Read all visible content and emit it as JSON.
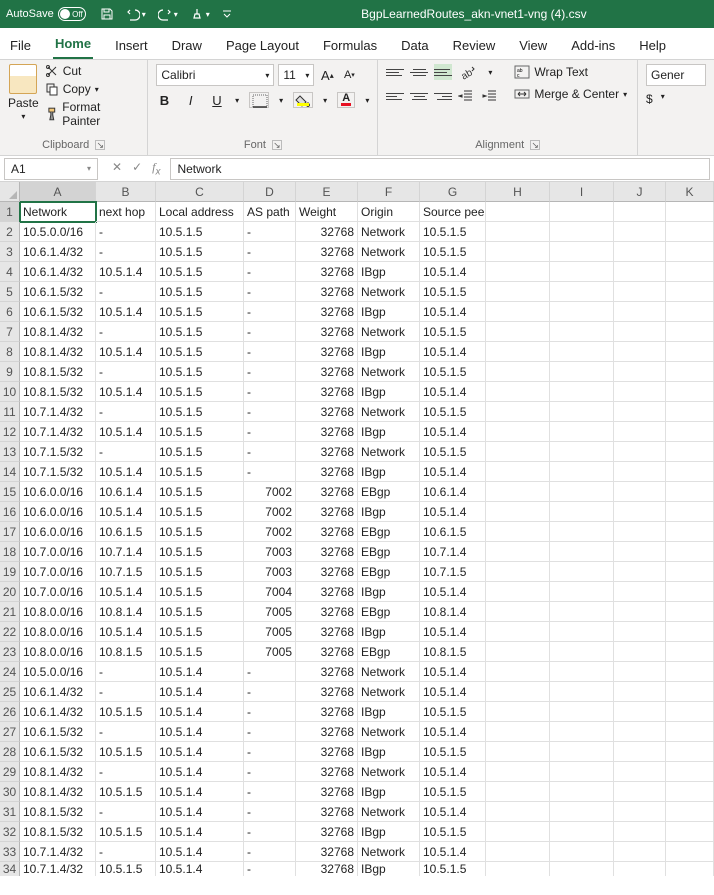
{
  "titlebar": {
    "autosave_label": "AutoSave",
    "autosave_state": "Off",
    "filename": "BgpLearnedRoutes_akn-vnet1-vng (4).csv"
  },
  "tabs": [
    "File",
    "Home",
    "Insert",
    "Draw",
    "Page Layout",
    "Formulas",
    "Data",
    "Review",
    "View",
    "Add-ins",
    "Help"
  ],
  "active_tab": "Home",
  "ribbon": {
    "clipboard": {
      "paste": "Paste",
      "cut": "Cut",
      "copy": "Copy",
      "format_painter": "Format Painter",
      "label": "Clipboard"
    },
    "font": {
      "name": "Calibri",
      "size": "11",
      "bold": "B",
      "italic": "I",
      "underline": "U",
      "label": "Font"
    },
    "alignment": {
      "wrap": "Wrap Text",
      "merge": "Merge & Center",
      "label": "Alignment"
    },
    "number": {
      "format": "Gener",
      "currency": "$"
    }
  },
  "namebox": "A1",
  "formula": "Network",
  "colHeaders": [
    "A",
    "B",
    "C",
    "D",
    "E",
    "F",
    "G",
    "H",
    "I",
    "J",
    "K"
  ],
  "headers": [
    "Network",
    "next hop",
    "Local address",
    "AS path",
    "Weight",
    "Origin",
    "Source peer"
  ],
  "rows": [
    [
      "10.5.0.0/16",
      "-",
      "10.5.1.5",
      "-",
      "32768",
      "Network",
      "10.5.1.5"
    ],
    [
      "10.6.1.4/32",
      "-",
      "10.5.1.5",
      "-",
      "32768",
      "Network",
      "10.5.1.5"
    ],
    [
      "10.6.1.4/32",
      "10.5.1.4",
      "10.5.1.5",
      "-",
      "32768",
      "IBgp",
      "10.5.1.4"
    ],
    [
      "10.6.1.5/32",
      "-",
      "10.5.1.5",
      "-",
      "32768",
      "Network",
      "10.5.1.5"
    ],
    [
      "10.6.1.5/32",
      "10.5.1.4",
      "10.5.1.5",
      "-",
      "32768",
      "IBgp",
      "10.5.1.4"
    ],
    [
      "10.8.1.4/32",
      "-",
      "10.5.1.5",
      "-",
      "32768",
      "Network",
      "10.5.1.5"
    ],
    [
      "10.8.1.4/32",
      "10.5.1.4",
      "10.5.1.5",
      "-",
      "32768",
      "IBgp",
      "10.5.1.4"
    ],
    [
      "10.8.1.5/32",
      "-",
      "10.5.1.5",
      "-",
      "32768",
      "Network",
      "10.5.1.5"
    ],
    [
      "10.8.1.5/32",
      "10.5.1.4",
      "10.5.1.5",
      "-",
      "32768",
      "IBgp",
      "10.5.1.4"
    ],
    [
      "10.7.1.4/32",
      "-",
      "10.5.1.5",
      "-",
      "32768",
      "Network",
      "10.5.1.5"
    ],
    [
      "10.7.1.4/32",
      "10.5.1.4",
      "10.5.1.5",
      "-",
      "32768",
      "IBgp",
      "10.5.1.4"
    ],
    [
      "10.7.1.5/32",
      "-",
      "10.5.1.5",
      "-",
      "32768",
      "Network",
      "10.5.1.5"
    ],
    [
      "10.7.1.5/32",
      "10.5.1.4",
      "10.5.1.5",
      "-",
      "32768",
      "IBgp",
      "10.5.1.4"
    ],
    [
      "10.6.0.0/16",
      "10.6.1.4",
      "10.5.1.5",
      "7002",
      "32768",
      "EBgp",
      "10.6.1.4"
    ],
    [
      "10.6.0.0/16",
      "10.5.1.4",
      "10.5.1.5",
      "7002",
      "32768",
      "IBgp",
      "10.5.1.4"
    ],
    [
      "10.6.0.0/16",
      "10.6.1.5",
      "10.5.1.5",
      "7002",
      "32768",
      "EBgp",
      "10.6.1.5"
    ],
    [
      "10.7.0.0/16",
      "10.7.1.4",
      "10.5.1.5",
      "7003",
      "32768",
      "EBgp",
      "10.7.1.4"
    ],
    [
      "10.7.0.0/16",
      "10.7.1.5",
      "10.5.1.5",
      "7003",
      "32768",
      "EBgp",
      "10.7.1.5"
    ],
    [
      "10.7.0.0/16",
      "10.5.1.4",
      "10.5.1.5",
      "7004",
      "32768",
      "IBgp",
      "10.5.1.4"
    ],
    [
      "10.8.0.0/16",
      "10.8.1.4",
      "10.5.1.5",
      "7005",
      "32768",
      "EBgp",
      "10.8.1.4"
    ],
    [
      "10.8.0.0/16",
      "10.5.1.4",
      "10.5.1.5",
      "7005",
      "32768",
      "IBgp",
      "10.5.1.4"
    ],
    [
      "10.8.0.0/16",
      "10.8.1.5",
      "10.5.1.5",
      "7005",
      "32768",
      "EBgp",
      "10.8.1.5"
    ],
    [
      "10.5.0.0/16",
      "-",
      "10.5.1.4",
      "-",
      "32768",
      "Network",
      "10.5.1.4"
    ],
    [
      "10.6.1.4/32",
      "-",
      "10.5.1.4",
      "-",
      "32768",
      "Network",
      "10.5.1.4"
    ],
    [
      "10.6.1.4/32",
      "10.5.1.5",
      "10.5.1.4",
      "-",
      "32768",
      "IBgp",
      "10.5.1.5"
    ],
    [
      "10.6.1.5/32",
      "-",
      "10.5.1.4",
      "-",
      "32768",
      "Network",
      "10.5.1.4"
    ],
    [
      "10.6.1.5/32",
      "10.5.1.5",
      "10.5.1.4",
      "-",
      "32768",
      "IBgp",
      "10.5.1.5"
    ],
    [
      "10.8.1.4/32",
      "-",
      "10.5.1.4",
      "-",
      "32768",
      "Network",
      "10.5.1.4"
    ],
    [
      "10.8.1.4/32",
      "10.5.1.5",
      "10.5.1.4",
      "-",
      "32768",
      "IBgp",
      "10.5.1.5"
    ],
    [
      "10.8.1.5/32",
      "-",
      "10.5.1.4",
      "-",
      "32768",
      "Network",
      "10.5.1.4"
    ],
    [
      "10.8.1.5/32",
      "10.5.1.5",
      "10.5.1.4",
      "-",
      "32768",
      "IBgp",
      "10.5.1.5"
    ],
    [
      "10.7.1.4/32",
      "-",
      "10.5.1.4",
      "-",
      "32768",
      "Network",
      "10.5.1.4"
    ],
    [
      "10.7.1.4/32",
      "10.5.1.5",
      "10.5.1.4",
      "-",
      "32768",
      "IBgp",
      "10.5.1.5"
    ]
  ]
}
